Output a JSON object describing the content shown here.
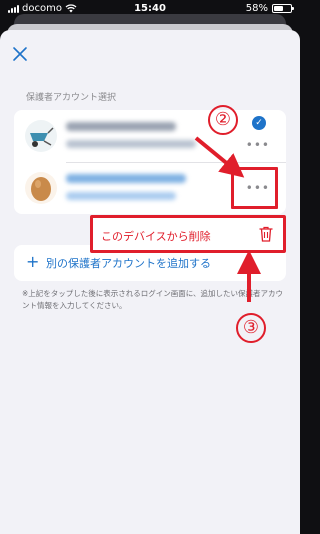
{
  "status_bar": {
    "carrier": "docomo",
    "time": "15:40",
    "battery": "58%",
    "battery_level": 0.58
  },
  "sheet": {
    "section_label": "保護者アカウント選択",
    "add_account_label": "別の保護者アカウントを追加する",
    "note": "※上記をタップした後に表示されるログイン画面に、追加したい保護者アカウント情報を入力してください。"
  },
  "context_menu": {
    "delete_label": "このデバイスから削除"
  },
  "annotations": {
    "step2": "②",
    "step3": "③"
  },
  "colors": {
    "accent": "#1e73c9",
    "annotation_red": "#e01e2b",
    "sheet_background": "#f2f2f7"
  }
}
